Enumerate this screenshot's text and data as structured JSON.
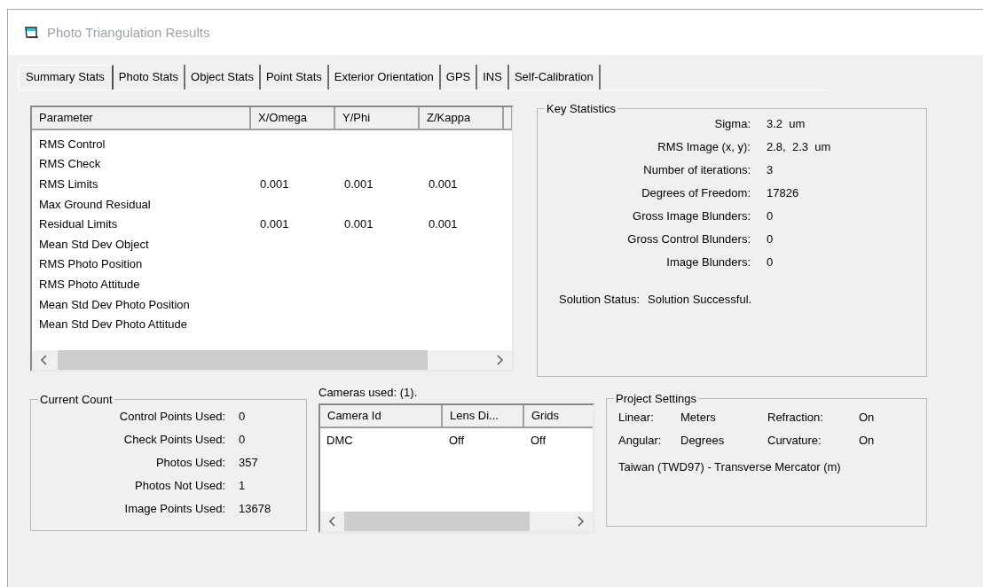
{
  "window": {
    "title": "Photo Triangulation Results"
  },
  "tabs": [
    {
      "label": "Summary Stats",
      "selected": true
    },
    {
      "label": "Photo Stats",
      "selected": false
    },
    {
      "label": "Object Stats",
      "selected": false
    },
    {
      "label": "Point Stats",
      "selected": false
    },
    {
      "label": "Exterior Orientation",
      "selected": false
    },
    {
      "label": "GPS",
      "selected": false
    },
    {
      "label": "INS",
      "selected": false
    },
    {
      "label": "Self-Calibration",
      "selected": false
    }
  ],
  "parameter_table": {
    "columns": [
      "Parameter",
      "X/Omega",
      "Y/Phi",
      "Z/Kappa"
    ],
    "rows": [
      {
        "parameter": "RMS Control"
      },
      {
        "parameter": "RMS Check"
      },
      {
        "parameter": "RMS Limits",
        "values": [
          "0.001",
          "0.001",
          "0.001"
        ]
      },
      {
        "parameter": "Max Ground Residual"
      },
      {
        "parameter": "Residual Limits",
        "values": [
          "0.001",
          "0.001",
          "0.001"
        ]
      },
      {
        "parameter": "Mean Std Dev Object"
      },
      {
        "parameter": "RMS Photo Position"
      },
      {
        "parameter": "RMS Photo Attitude"
      },
      {
        "parameter": "Mean Std Dev Photo Position"
      },
      {
        "parameter": "Mean Std Dev Photo Attitude"
      }
    ]
  },
  "key_statistics": {
    "title": "Key Statistics",
    "items": [
      {
        "label": "Sigma:",
        "value": "3.2  um"
      },
      {
        "label": "RMS Image (x, y):",
        "value": "2.8,  2.3  um"
      },
      {
        "label": "Number of iterations:",
        "value": "3"
      },
      {
        "label": "Degrees of Freedom:",
        "value": "17826"
      },
      {
        "label": "Gross Image Blunders:",
        "value": "0"
      },
      {
        "label": "Gross Control Blunders:",
        "value": "0"
      },
      {
        "label": "Image Blunders:",
        "value": "0"
      }
    ],
    "solution_status": {
      "label": "Solution Status:",
      "value": "Solution Successful."
    }
  },
  "current_count": {
    "title": "Current Count",
    "items": [
      {
        "label": "Control Points Used:",
        "value": "0"
      },
      {
        "label": "Check Points Used:",
        "value": "0"
      },
      {
        "label": "Photos Used:",
        "value": "357"
      },
      {
        "label": "Photos Not Used:",
        "value": "1"
      },
      {
        "label": "Image Points Used:",
        "value": "13678"
      }
    ]
  },
  "cameras": {
    "caption": "Cameras used: (1).",
    "columns": [
      "Camera Id",
      "Lens Di...",
      "Grids"
    ],
    "rows": [
      [
        "DMC",
        "Off",
        "Off"
      ]
    ]
  },
  "project_settings": {
    "title": "Project Settings",
    "rows": [
      [
        {
          "label": "Linear:",
          "value": "Meters"
        },
        {
          "label": "Refraction:",
          "value": "On"
        }
      ],
      [
        {
          "label": "Angular:",
          "value": "Degrees"
        },
        {
          "label": "Curvature:",
          "value": "On"
        }
      ]
    ],
    "projection": "Taiwan (TWD97) - Transverse Mercator (m)"
  }
}
